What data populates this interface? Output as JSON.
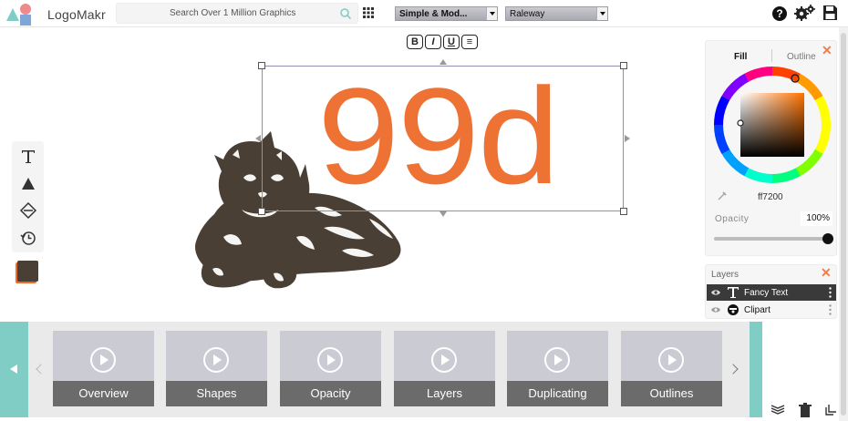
{
  "app": {
    "brand": "LogoMakr"
  },
  "search": {
    "placeholder": "Search Over 1 Million Graphics"
  },
  "toolbar": {
    "category_select": "Simple & Mod...",
    "font_select": "Raleway"
  },
  "text_format": {
    "bold": "B",
    "italic": "I",
    "underline": "U",
    "align": "≡"
  },
  "canvas": {
    "fancy_text": "99d",
    "text_color": "#ef7235",
    "clipart_color": "#4a3f35"
  },
  "color_panel": {
    "tab_fill": "Fill",
    "tab_outline": "Outline",
    "hex": "ff7200",
    "opacity_label": "Opacity",
    "opacity_value": "100%",
    "opacity": 1.0
  },
  "layers": {
    "title": "Layers",
    "items": [
      {
        "name": "Fancy Text",
        "icon": "text-icon",
        "selected": true
      },
      {
        "name": "Clipart",
        "icon": "clipart-icon",
        "selected": false
      }
    ]
  },
  "tutorials": {
    "items": [
      "Overview",
      "Shapes",
      "Opacity",
      "Layers",
      "Duplicating",
      "Outlines"
    ]
  },
  "colors": {
    "accent_teal": "#7fcdc4",
    "close_orange": "#ef7e4b"
  }
}
